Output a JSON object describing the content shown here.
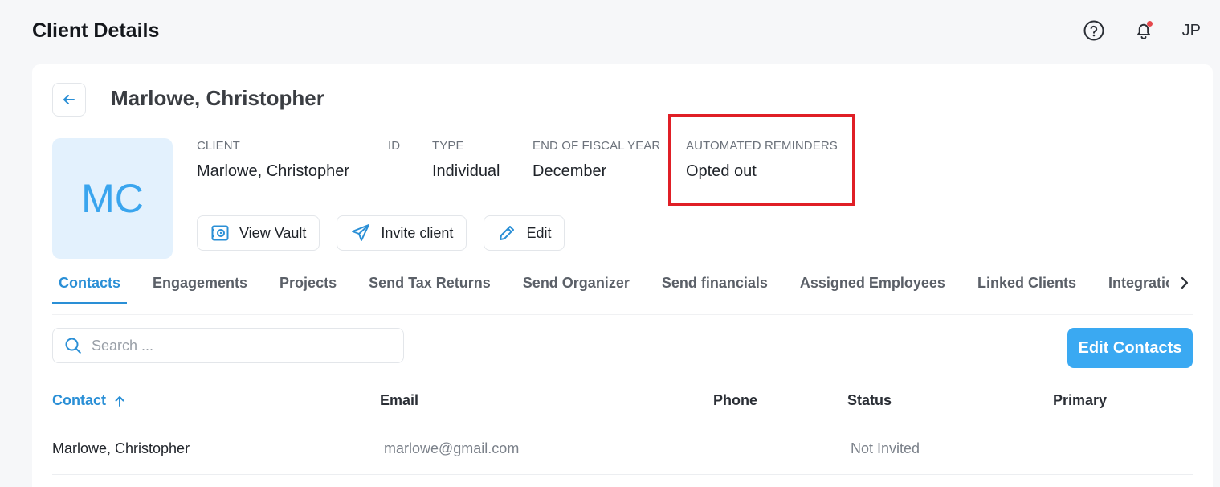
{
  "header": {
    "title": "Client Details",
    "user_initials": "JP",
    "icons": [
      "help-icon",
      "bell-icon"
    ]
  },
  "client": {
    "name": "Marlowe, Christopher",
    "avatar_initials": "MC",
    "fields": [
      {
        "label": "CLIENT",
        "value": "Marlowe, Christopher"
      },
      {
        "label": "ID",
        "value": ""
      },
      {
        "label": "TYPE",
        "value": "Individual"
      },
      {
        "label": "END OF FISCAL YEAR",
        "value": "December"
      },
      {
        "label": "AUTOMATED REMINDERS",
        "value": "Opted out"
      }
    ]
  },
  "actions": {
    "view_vault": "View Vault",
    "invite_client": "Invite client",
    "edit": "Edit"
  },
  "tabs": [
    {
      "label": "Contacts",
      "active": true
    },
    {
      "label": "Engagements"
    },
    {
      "label": "Projects"
    },
    {
      "label": "Send Tax Returns"
    },
    {
      "label": "Send Organizer"
    },
    {
      "label": "Send financials"
    },
    {
      "label": "Assigned Employees"
    },
    {
      "label": "Linked Clients"
    },
    {
      "label": "Integrations"
    }
  ],
  "search": {
    "placeholder": "Search ..."
  },
  "edit_contacts_label": "Edit Contacts",
  "table": {
    "columns": [
      "Contact",
      "Email",
      "Phone",
      "Status",
      "Primary"
    ],
    "rows": [
      {
        "contact": "Marlowe, Christopher",
        "email": "marlowe@gmail.com",
        "phone": "",
        "status": "Not Invited",
        "primary": ""
      }
    ]
  },
  "colors": {
    "accent": "#3aa9f2",
    "active_tab": "#2a8fd6",
    "highlight": "#e01f26",
    "avatar_bg": "#e3f1fd"
  }
}
